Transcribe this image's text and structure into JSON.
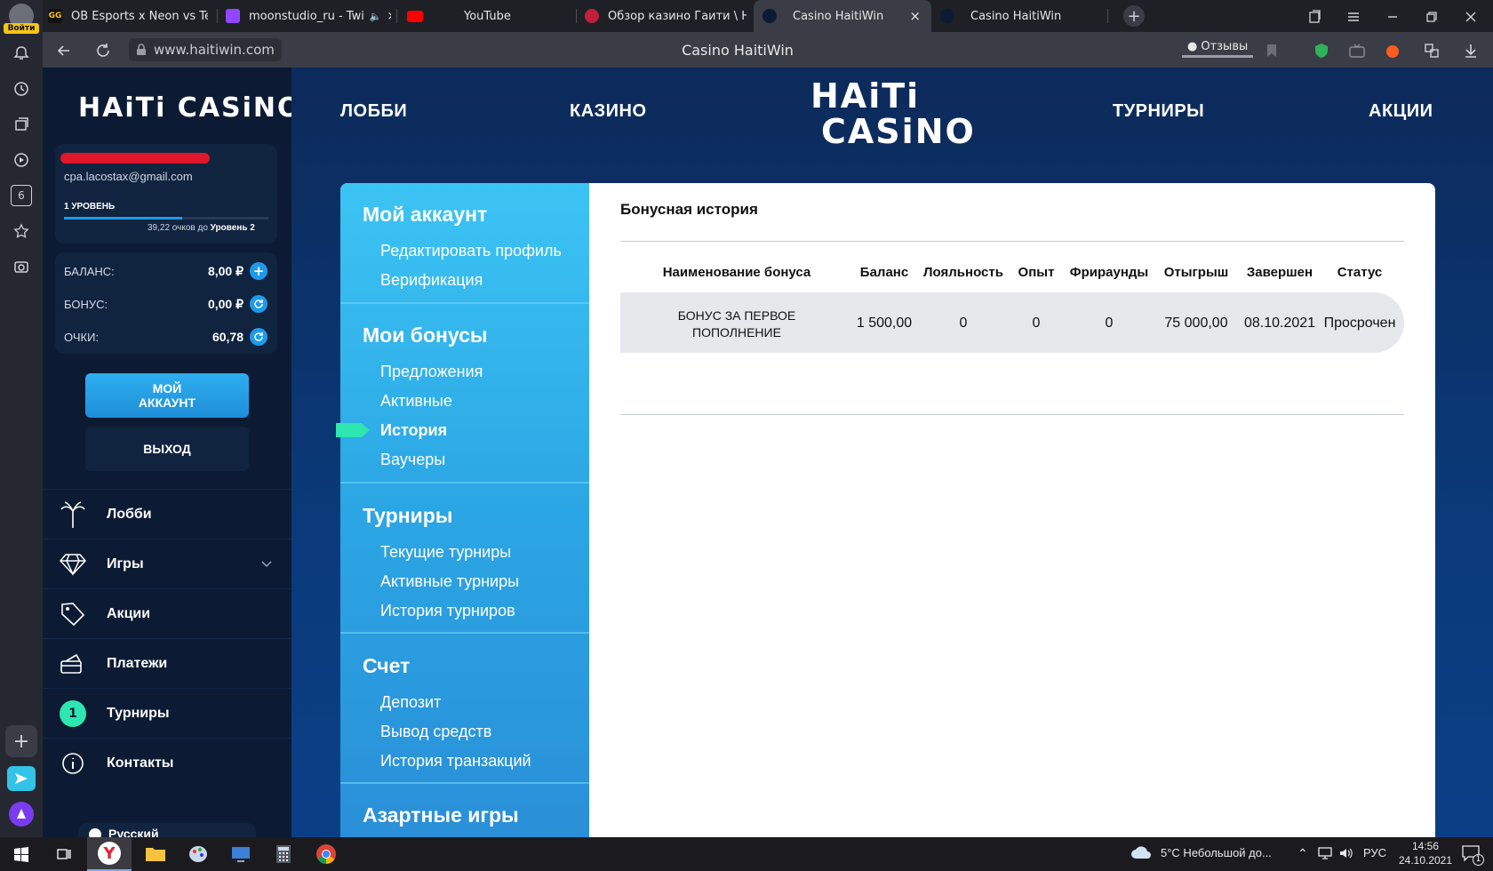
{
  "browser": {
    "login_label": "Войти",
    "tabs": [
      {
        "title": "OB Esports x Neon vs Team",
        "icon": "gg-icon"
      },
      {
        "title": "moonstudio_ru - Twi",
        "icon": "twitch-icon"
      },
      {
        "title": "YouTube",
        "icon": "youtube-icon"
      },
      {
        "title": "Обзор казино Гаити \\ HAI",
        "icon": "casino-review-icon"
      },
      {
        "title": "Casino HaitiWin",
        "icon": "haiti-icon",
        "active": true
      },
      {
        "title": "Casino HaitiWin",
        "icon": "haiti-icon"
      }
    ],
    "url": "www.haitiwin.com",
    "page_title": "Casino HaitiWin",
    "reviews_label": "Отзывы",
    "tab_count_badge": "6"
  },
  "site": {
    "logo_line1": "HAiTi",
    "logo_line2": "CASiNO",
    "sidebar_logo": "HAiTi CASiNO",
    "user": {
      "email": "cpa.lacostax@gmail.com",
      "level": "1 УРОВЕНЬ",
      "progress_text": "39,22 очков до",
      "progress_target": "Уровень 2",
      "progress_fraction": 0.58
    },
    "balance": [
      {
        "label": "БАЛАНС:",
        "value": "8,00 ₽",
        "icon": "plus-icon"
      },
      {
        "label": "БОНУС:",
        "value": "0,00 ₽",
        "icon": "refresh-icon"
      },
      {
        "label": "ОЧКИ:",
        "value": "60,78",
        "icon": "refresh-icon"
      }
    ],
    "account_button": "МОЙ АККАУНТ",
    "logout_button": "ВЫХОД",
    "nav": [
      {
        "label": "Лобби",
        "icon": "palm-icon"
      },
      {
        "label": "Игры",
        "icon": "diamond-icon"
      },
      {
        "label": "Акции",
        "icon": "tag-icon"
      },
      {
        "label": "Платежи",
        "icon": "card-icon"
      },
      {
        "label": "Турниры",
        "icon": "badge",
        "badge": "1"
      },
      {
        "label": "Контакты",
        "icon": "info-icon"
      }
    ],
    "language_partial": "Русский",
    "topnav": [
      "ЛОББИ",
      "КАЗИНО",
      "ТУРНИРЫ",
      "АКЦИИ"
    ],
    "menu": {
      "sections": [
        {
          "title": "Мой аккаунт",
          "items": [
            "Редактировать профиль",
            "Верификация"
          ]
        },
        {
          "title": "Мои бонусы",
          "items": [
            "Предложения",
            "Активные",
            "История",
            "Ваучеры"
          ]
        },
        {
          "title": "Турниры",
          "items": [
            "Текущие турниры",
            "Активные турниры",
            "История турниров"
          ]
        },
        {
          "title": "Счет",
          "items": [
            "Депозит",
            "Вывод средств",
            "История транзакций"
          ]
        },
        {
          "title": "Азартные игры",
          "items": []
        }
      ],
      "active_item": "История"
    },
    "content": {
      "title": "Бонусная история",
      "columns": [
        "Наименование бонуса",
        "Баланс",
        "Лояльность",
        "Опыт",
        "Фрираунды",
        "Отыгрыш",
        "Завершен",
        "Статус"
      ],
      "rows": [
        [
          "БОНУС ЗА ПЕРВОЕ ПОПОЛНЕНИЕ",
          "1 500,00",
          "0",
          "0",
          "0",
          "75 000,00",
          "08.10.2021",
          "Просрочен"
        ]
      ]
    }
  },
  "taskbar": {
    "weather": "5°C  Небольшой до...",
    "lang": "РУС",
    "time": "14:56",
    "date": "24.10.2021",
    "notif_badge": "1"
  },
  "colors": {
    "accent": "#1e9be8",
    "menu_active_marker": "#2ee6b0",
    "sidebar_bg": "#0c1b33"
  }
}
